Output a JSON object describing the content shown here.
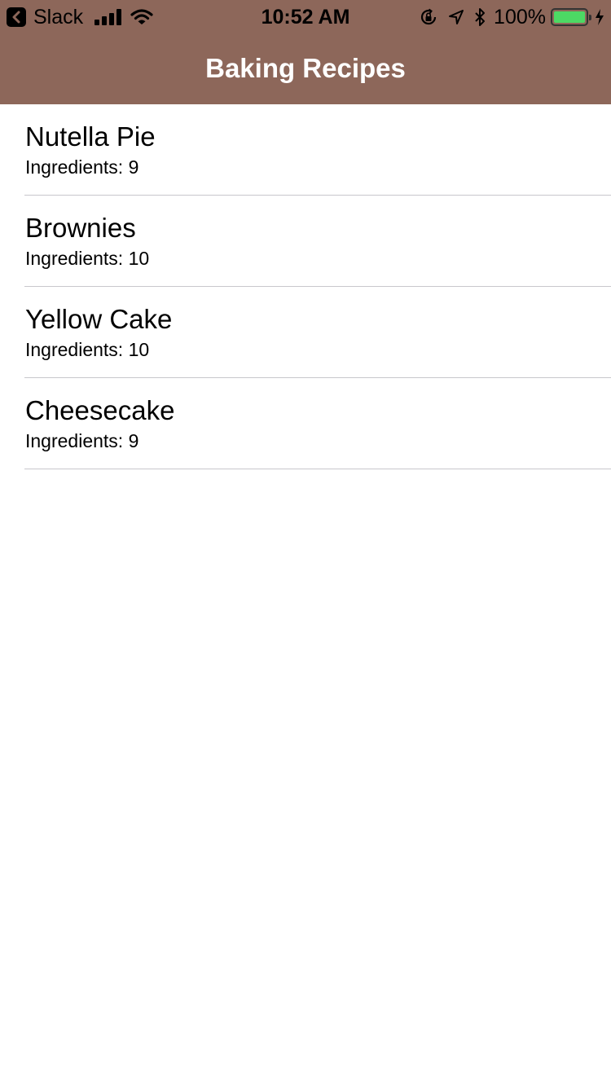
{
  "status_bar": {
    "back_app_label": "Slack",
    "time": "10:52 AM",
    "battery_percent": "100%",
    "battery_level": 1.0,
    "battery_color": "#4cd964"
  },
  "nav_bar": {
    "title": "Baking Recipes",
    "background_color": "#8d675a"
  },
  "recipes": [
    {
      "name": "Nutella Pie",
      "ingredients_label": "Ingredients: 9"
    },
    {
      "name": "Brownies",
      "ingredients_label": "Ingredients: 10"
    },
    {
      "name": "Yellow Cake",
      "ingredients_label": "Ingredients: 10"
    },
    {
      "name": "Cheesecake",
      "ingredients_label": "Ingredients: 9"
    }
  ]
}
